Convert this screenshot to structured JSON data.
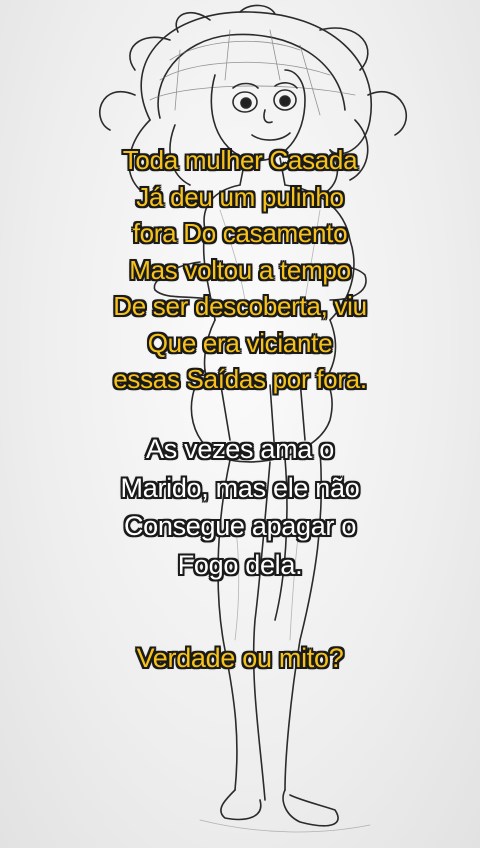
{
  "caption_yellow": {
    "lines": [
      "Toda mulher Casada",
      "Já deu um pulinho",
      "fora Do casamento",
      "Mas voltou a tempo",
      "De ser descoberta, viu",
      "Que era viciante",
      "essas Saídas por fora."
    ]
  },
  "caption_white": {
    "lines": [
      "As vezes ama o",
      "Marido, mas ele não",
      "Consegue apagar o",
      "Fogo dela."
    ]
  },
  "question": "Verdade ou mito?",
  "colors": {
    "highlight_text": "#f6c21a",
    "body_text": "#ffffff",
    "outline": "#1a1a1a"
  },
  "illustration": {
    "icon": "pencil-sketch-cartoon-woman"
  }
}
